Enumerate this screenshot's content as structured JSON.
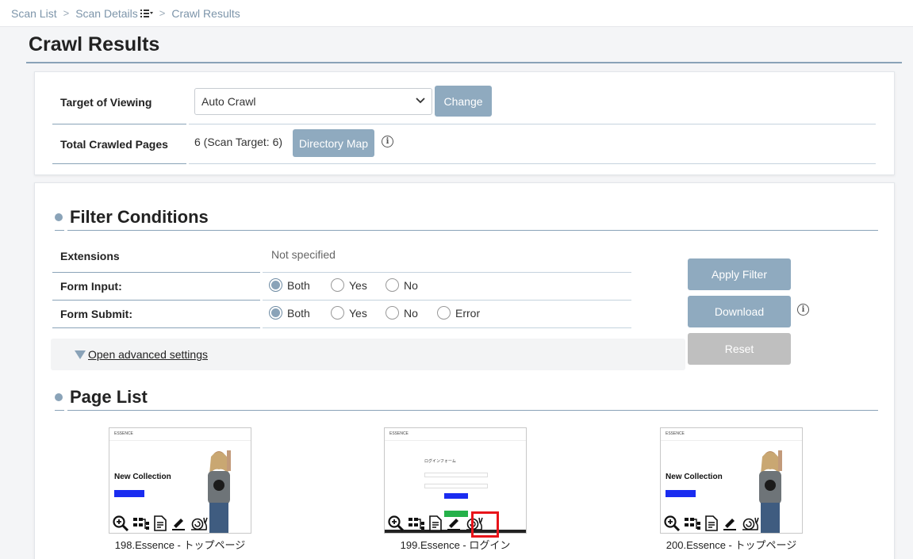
{
  "breadcrumb": {
    "items": [
      "Scan List",
      "Scan Details",
      "Crawl Results"
    ],
    "separator": ">"
  },
  "page_title": "Crawl Results",
  "view_card": {
    "target_label": "Target of Viewing",
    "target_value": "Auto Crawl",
    "change_button": "Change",
    "pages_label": "Total Crawled Pages",
    "pages_value": "6 (Scan Target: 6)",
    "directory_button": "Directory Map"
  },
  "filter": {
    "heading": "Filter Conditions",
    "extensions_label": "Extensions",
    "extensions_value": "Not specified",
    "form_input_label": "Form Input:",
    "form_input_options": [
      "Both",
      "Yes",
      "No"
    ],
    "form_input_selected": "Both",
    "form_submit_label": "Form Submit:",
    "form_submit_options": [
      "Both",
      "Yes",
      "No",
      "Error"
    ],
    "form_submit_selected": "Both",
    "apply_button": "Apply Filter",
    "download_button": "Download",
    "reset_button": "Reset",
    "advanced_link": "Open advanced settings"
  },
  "page_list": {
    "heading": "Page List",
    "pages": [
      {
        "caption": "198.Essence - トップページ",
        "hero_title": "New Collection",
        "kind": "home"
      },
      {
        "caption": "199.Essence - ログイン",
        "login_title": "ログインフォーム",
        "kind": "login"
      },
      {
        "caption": "200.Essence - トップページ",
        "hero_title": "New Collection",
        "kind": "home"
      }
    ],
    "thumb_brand": "ESSENCE",
    "card_icons": [
      "zoom-in-icon",
      "sitemap-icon",
      "document-icon",
      "edit-icon",
      "snail-icon"
    ]
  },
  "colors": {
    "accent": "#8faabf",
    "rule": "#8aa3b8",
    "highlight": "#e8141a",
    "disabled": "#bfbfbf"
  }
}
